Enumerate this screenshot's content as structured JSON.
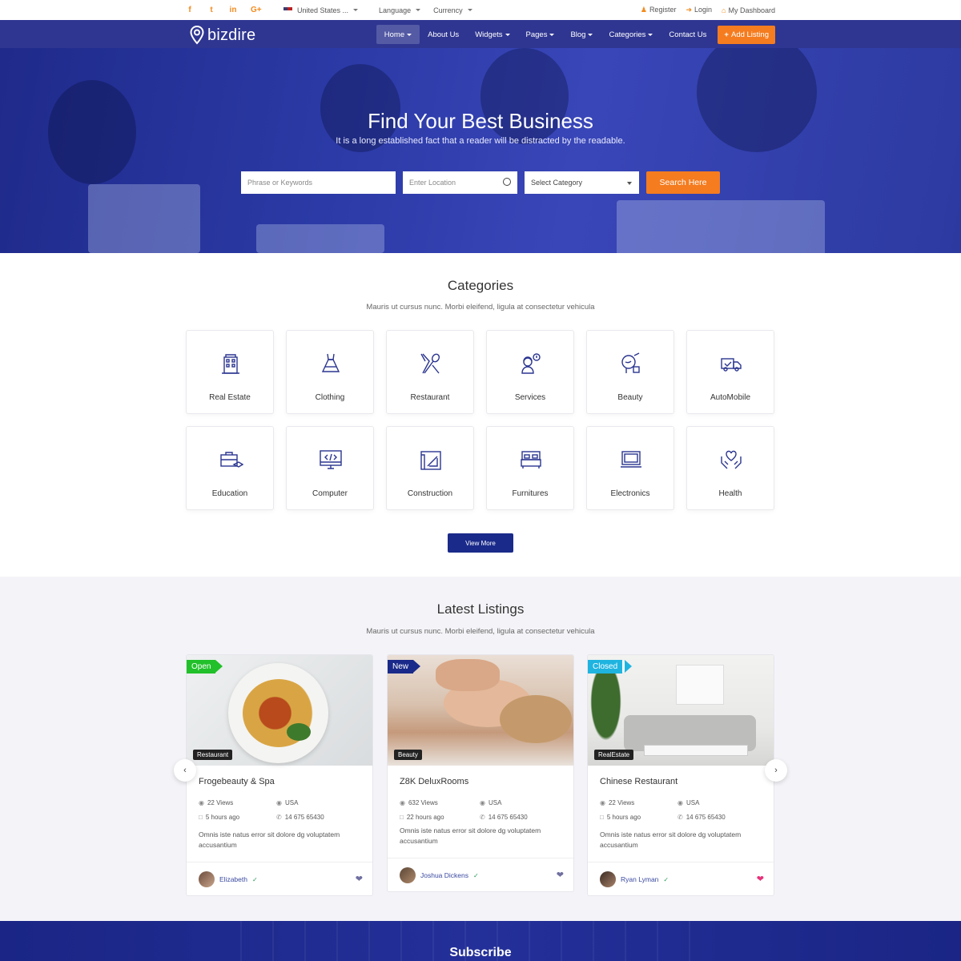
{
  "topbar": {
    "social": [
      "f",
      "t",
      "in",
      "G+"
    ],
    "country": "United States ...",
    "language": "Language",
    "currency": "Currency",
    "register": "Register",
    "login": "Login",
    "dashboard": "My Dashboard"
  },
  "nav": {
    "logo": "bizdire",
    "items": [
      "Home",
      "About Us",
      "Widgets",
      "Pages",
      "Blog",
      "Categories",
      "Contact Us"
    ],
    "add_listing": "Add Listing"
  },
  "hero": {
    "title": "Find Your Best Business",
    "subtitle": "It is a long established fact that a reader will be distracted by the readable.",
    "keyword_placeholder": "Phrase or Keywords",
    "location_placeholder": "Enter Location",
    "category_select": "Select Category",
    "search_button": "Search Here"
  },
  "categories": {
    "title": "Categories",
    "subtitle": "Mauris ut cursus nunc. Morbi eleifend, ligula at consectetur vehicula",
    "items": [
      {
        "label": "Real Estate",
        "icon": "building-icon"
      },
      {
        "label": "Clothing",
        "icon": "dress-icon"
      },
      {
        "label": "Restaurant",
        "icon": "fork-spoon-icon"
      },
      {
        "label": "Services",
        "icon": "support-agent-icon"
      },
      {
        "label": "Beauty",
        "icon": "beauty-icon"
      },
      {
        "label": "AutoMobile",
        "icon": "truck-icon"
      },
      {
        "label": "Education",
        "icon": "education-icon"
      },
      {
        "label": "Computer",
        "icon": "monitor-code-icon"
      },
      {
        "label": "Construction",
        "icon": "blueprint-icon"
      },
      {
        "label": "Furnitures",
        "icon": "bed-icon"
      },
      {
        "label": "Electronics",
        "icon": "laptop-icon"
      },
      {
        "label": "Health",
        "icon": "heart-hands-icon"
      }
    ],
    "view_more": "View More"
  },
  "listings": {
    "title": "Latest Listings",
    "subtitle": "Mauris ut cursus nunc. Morbi eleifend, ligula at consectetur vehicula",
    "cards": [
      {
        "status": "Open",
        "status_color": "#22c02a",
        "category": "Restaurant",
        "title": "Frogebeauty & Spa",
        "views": "22 Views",
        "location": "USA",
        "time": "5 hours ago",
        "phone": "14 675 65430",
        "desc": "Omnis iste natus error sit dolore dg voluptatem accusantium",
        "author": "Elizabeth",
        "heart_color": "#6f6fa0"
      },
      {
        "status": "New",
        "status_color": "#1a2a8a",
        "category": "Beauty",
        "title": "Z8K DeluxRooms",
        "views": "632 Views",
        "location": "USA",
        "time": "22 hours ago",
        "phone": "14 675 65430",
        "desc": "Omnis iste natus error sit dolore dg voluptatem accusantium",
        "author": "Joshua Dickens",
        "heart_color": "#6f6fa0"
      },
      {
        "status": "Closed",
        "status_color": "#1fb4e0",
        "category": "RealEstate",
        "title": "Chinese Restaurant",
        "views": "22 Views",
        "location": "USA",
        "time": "5 hours ago",
        "phone": "14 675 65430",
        "desc": "Omnis iste natus error sit dolore dg voluptatem accusantium",
        "author": "Ryan Lyman",
        "heart_color": "#e8317a"
      }
    ]
  },
  "subscribe": {
    "title": "Subscribe"
  },
  "colors": {
    "brand": "#1a2a8a",
    "accent": "#f57c1f"
  }
}
